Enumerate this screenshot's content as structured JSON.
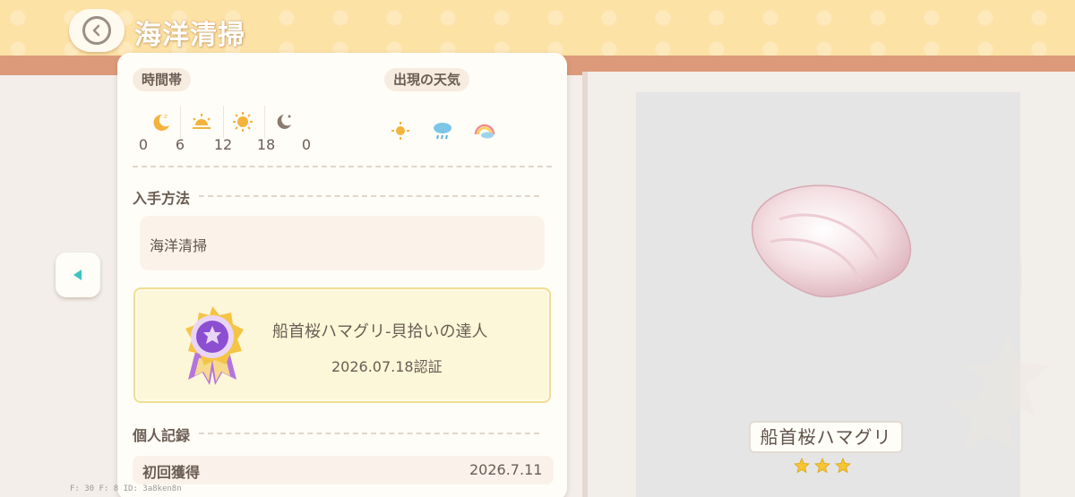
{
  "header": {
    "title": "海洋清掃"
  },
  "time_section": {
    "label": "時間帯",
    "icons": [
      "moon-sleep-icon",
      "sunrise-icon",
      "sun-icon",
      "moon-star-icon"
    ],
    "ticks": [
      "0",
      "6",
      "12",
      "18",
      "0"
    ]
  },
  "weather_section": {
    "label": "出現の天気",
    "icons": [
      "sun-icon",
      "rain-cloud-icon",
      "rainbow-icon"
    ]
  },
  "method": {
    "label": "入手方法",
    "value": "海洋清掃"
  },
  "achievement": {
    "title": "船首桜ハマグリ-貝拾いの達人",
    "date": "2026.07.18認証"
  },
  "record": {
    "label": "個人記録",
    "first_label": "初回獲得",
    "first_value": "2026.7.11"
  },
  "item": {
    "name": "船首桜ハマグリ",
    "stars": 3
  },
  "colors": {
    "accent_header": "#fde2a6",
    "band": "#dd9a7a",
    "nav_arrow": "#3cc4c0",
    "star": "#f7c531"
  },
  "debug": {
    "text": "F: 30    F: 8    ID: 3a8ken8n"
  }
}
